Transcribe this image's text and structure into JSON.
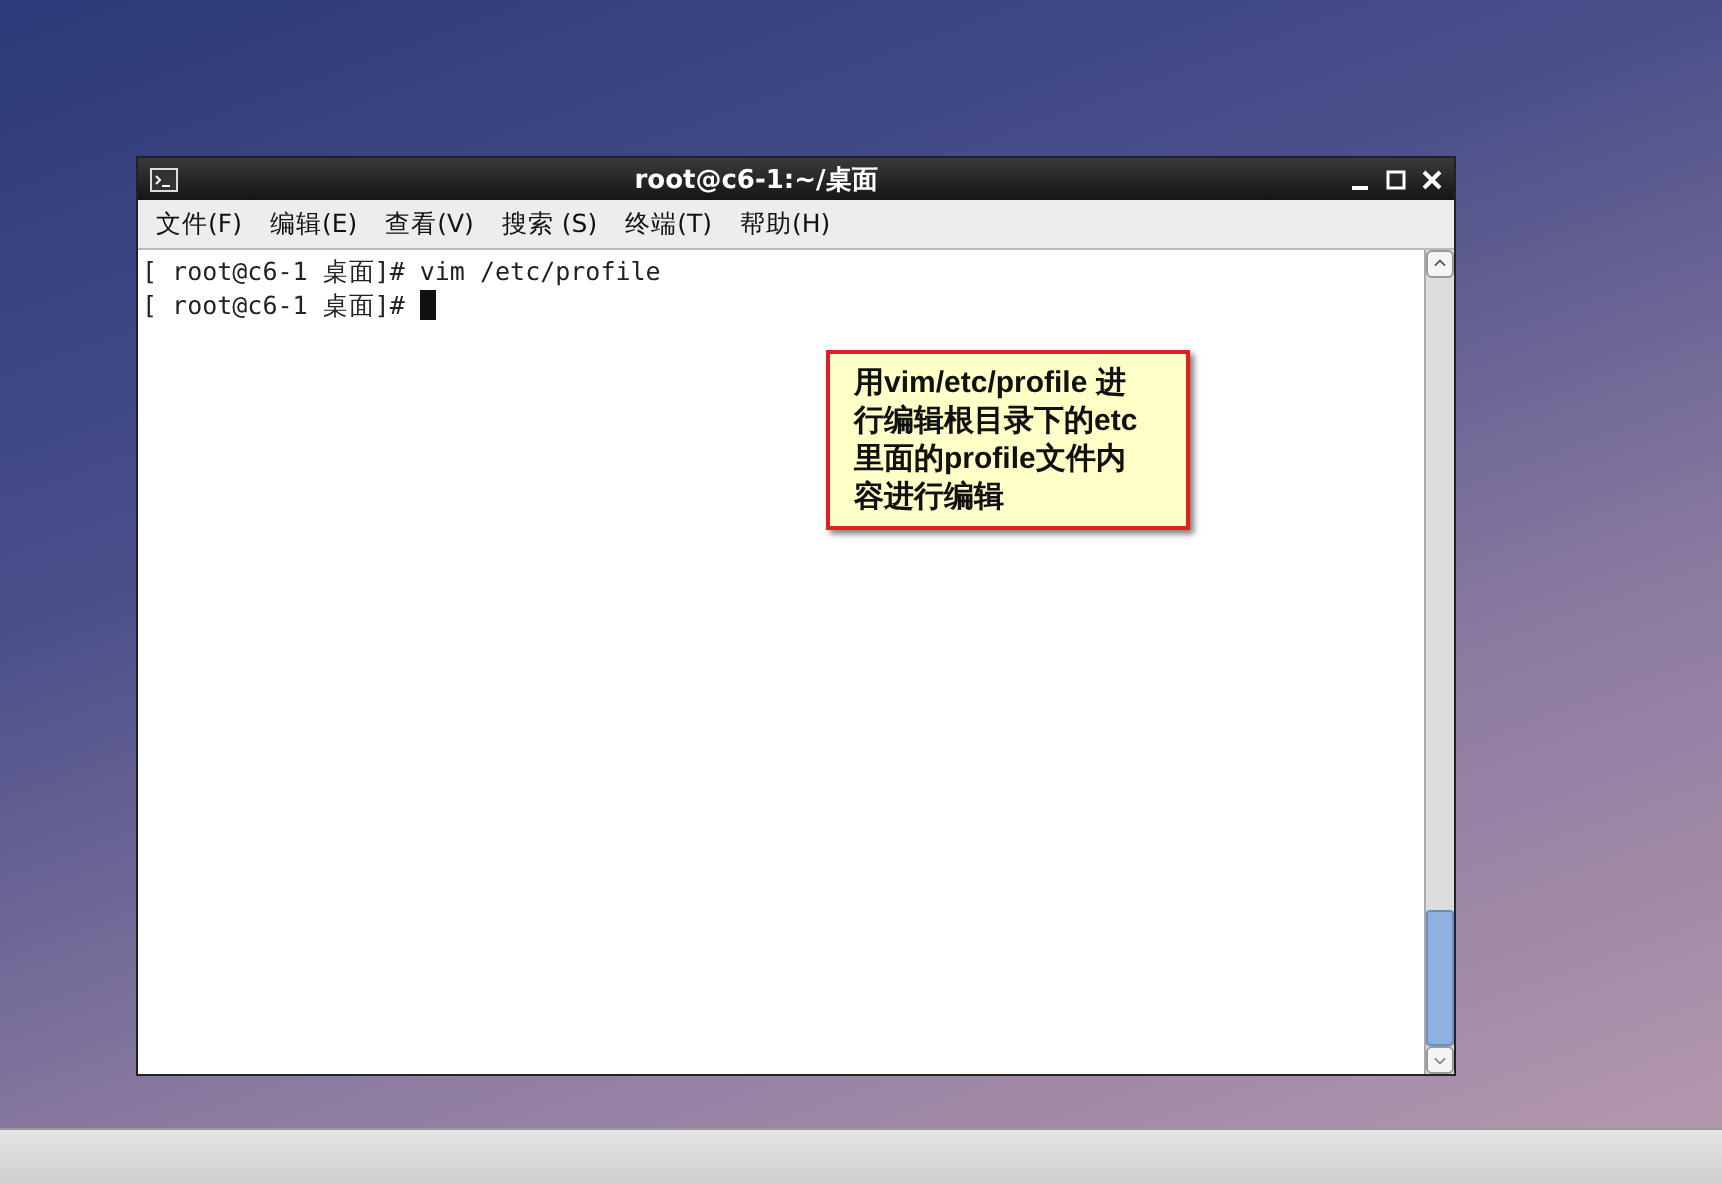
{
  "window": {
    "title": "root@c6-1:~/桌面"
  },
  "menu": [
    "文件(F)",
    "编辑(E)",
    "查看(V)",
    "搜索 (S)",
    "终端(T)",
    "帮助(H)"
  ],
  "terminal": {
    "lines": [
      {
        "text": "[ root@c6-1 桌面]# vim /etc/profile",
        "cursor": false
      },
      {
        "text": "[ root@c6-1 桌面]# ",
        "cursor": true
      }
    ]
  },
  "callout": {
    "text": "用vim/etc/profile 进行编辑根目录下的etc里面的profile文件内容进行编辑"
  }
}
